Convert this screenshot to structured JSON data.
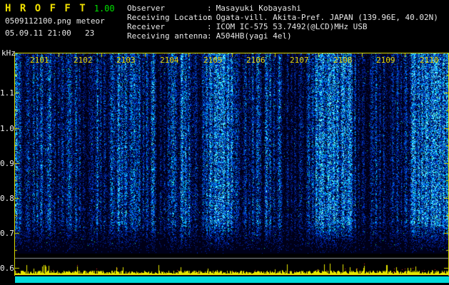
{
  "header": {
    "app_title": "H R O F F T",
    "version": "1.00",
    "filename": "0509112100.png",
    "mode": "meteor",
    "timestamp": "05.09.11 21:00",
    "count": "23",
    "separator": ":",
    "meta": [
      {
        "label": "Observer",
        "value": "Masayuki Kobayashi"
      },
      {
        "label": "Receiving Location",
        "value": "Ogata-vill. Akita-Pref. JAPAN (139.96E, 40.02N)"
      },
      {
        "label": "Receiver",
        "value": "ICOM IC-575 53.7492(@LCD)MHz USB"
      },
      {
        "label": "Receiving antenna",
        "value": "A504HB(yagi 4el)"
      }
    ]
  },
  "spectrogram": {
    "unit_label": "kHz",
    "freq_labels": [
      "1.1",
      "1.0",
      "0.9",
      "0.8",
      "0.7",
      "0.6"
    ],
    "time_labels": [
      "2101",
      "2102",
      "2103",
      "2104",
      "2105",
      "2106",
      "2107",
      "2108",
      "2109",
      "2110"
    ],
    "freq_axis_range_khz": [
      0.6,
      1.2
    ],
    "time_axis_span": "21:00 - 21:10",
    "colors": {
      "accent": "#d8d800",
      "bar": "#00dcdc",
      "title": "#f0e000",
      "version": "#00e000",
      "time_label": "#e8d800",
      "background": "#000000",
      "noise_bg": "#000018",
      "noise_palette": [
        "#0020a0",
        "#0046e1",
        "#008cfa",
        "#00d0ff",
        "#70ffff"
      ],
      "green_fleck": "#20f090",
      "signal_trace": "#e8e800",
      "signal_peak": "#ff2828",
      "baseline_gray": "#969aa0"
    }
  }
}
